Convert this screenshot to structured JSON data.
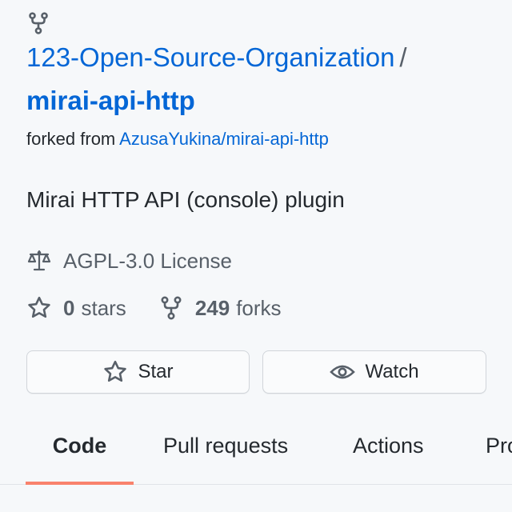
{
  "repo": {
    "owner": "123-Open-Source-Organization",
    "separator": "/",
    "name": "mirai-api-http",
    "forked_prefix": "forked from",
    "forked_source": "AzusaYukina/mirai-api-http",
    "description": "Mirai HTTP API (console) plugin",
    "license": "AGPL-3.0 License"
  },
  "stats": {
    "stars_count": "0",
    "stars_label": "stars",
    "forks_count": "249",
    "forks_label": "forks"
  },
  "buttons": {
    "star_label": "Star",
    "watch_label": "Watch"
  },
  "tabs": [
    {
      "label": "Code",
      "active": true
    },
    {
      "label": "Pull requests",
      "active": false
    },
    {
      "label": "Actions",
      "active": false
    },
    {
      "label": "Projects",
      "active": false
    }
  ],
  "colors": {
    "link": "#0366d6",
    "muted": "#586069",
    "text": "#24292e",
    "active_tab_underline": "#f9826c",
    "background": "#f6f8fa"
  },
  "icons": {
    "repo_type": "fork-icon",
    "license": "law-icon",
    "stars": "star-icon",
    "forks": "fork-icon",
    "watch": "eye-icon"
  }
}
